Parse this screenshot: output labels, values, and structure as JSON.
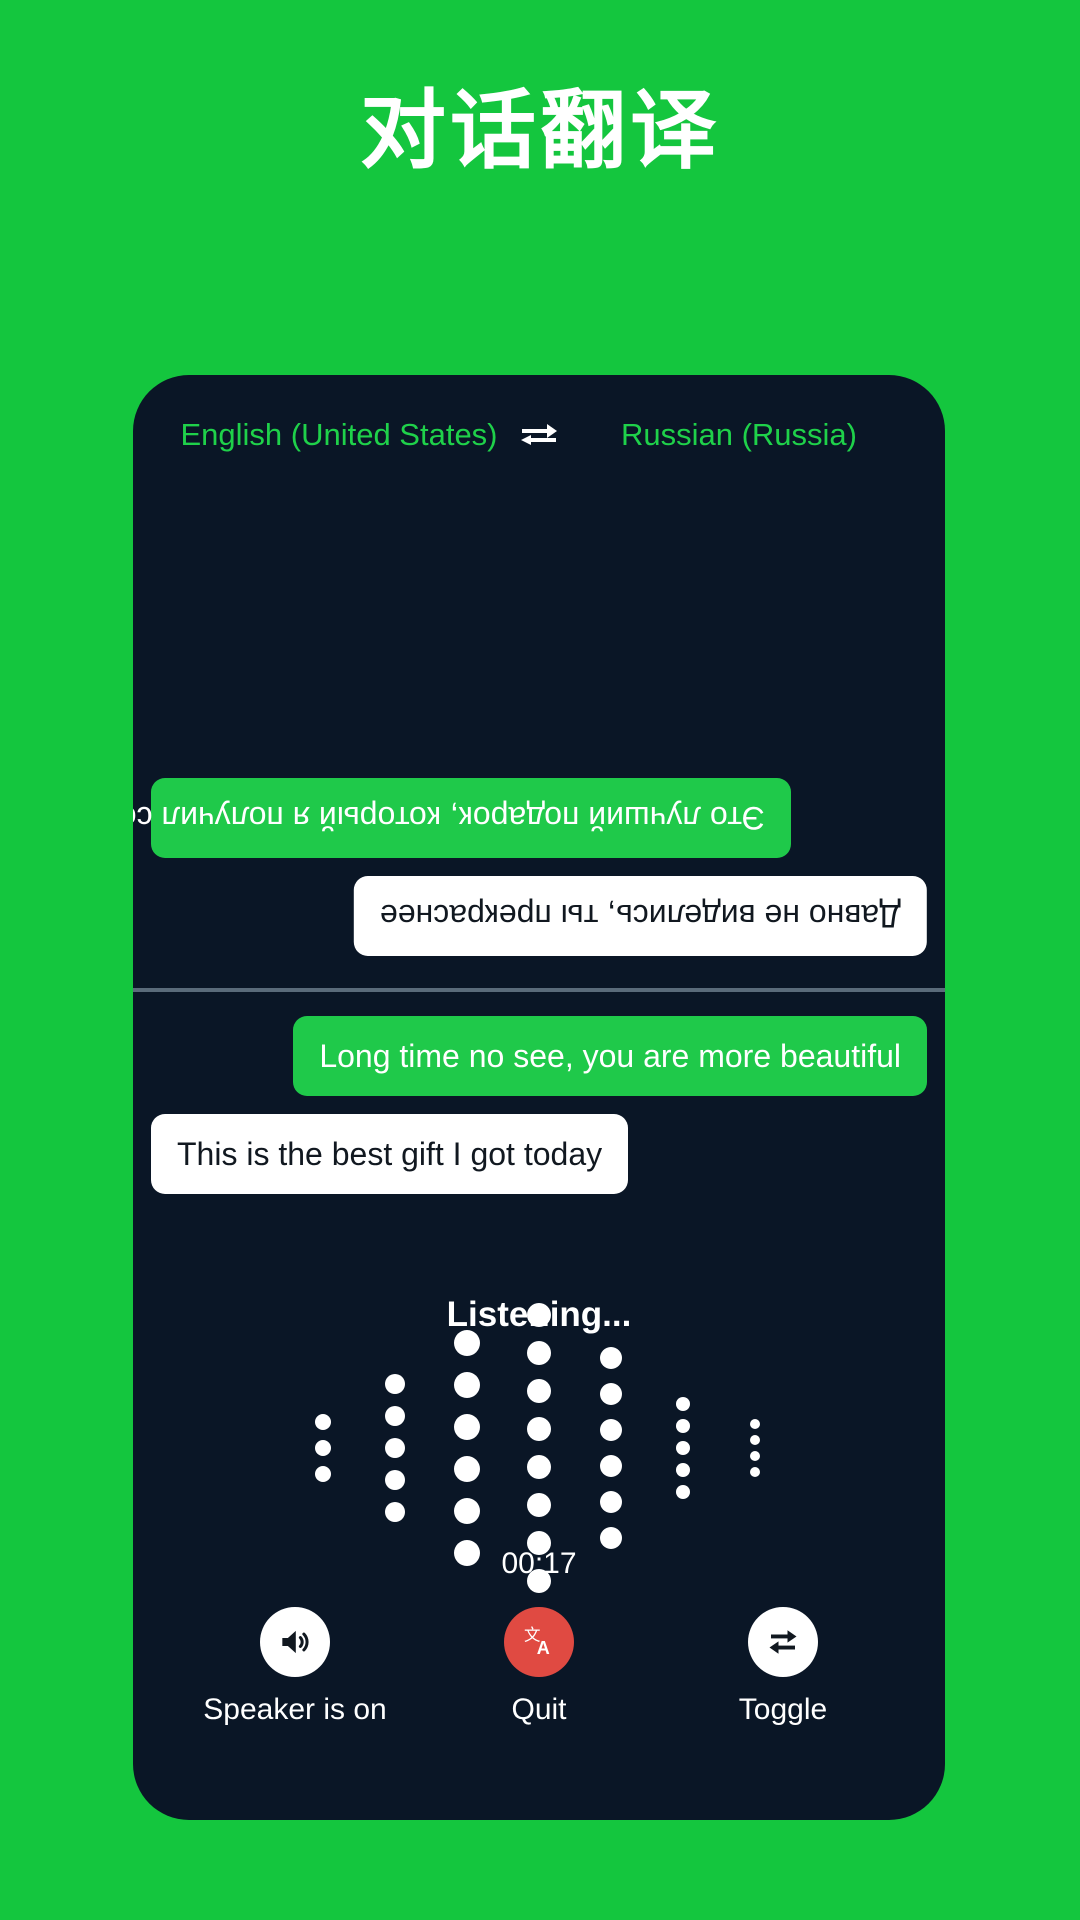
{
  "page": {
    "title": "对话翻译",
    "background_color": "#14C63E"
  },
  "phone": {
    "background_color": "#0A1626",
    "languages": {
      "source": "English (United States)",
      "target": "Russian (Russia)",
      "swap_icon": "swap-horizontal-icon",
      "text_color": "#1FD14A"
    },
    "conversation": {
      "remote_pane_rotated": true,
      "remote_messages": [
        {
          "text": "Это лучший подарок, который я получил сегодня",
          "style": "green",
          "align": "left",
          "language": "Russian"
        },
        {
          "text": "Давно не виделись, ты прекраснее",
          "style": "white",
          "align": "right",
          "language": "Russian"
        }
      ],
      "local_messages": [
        {
          "text": "Long time no see, you are more beautiful",
          "style": "green",
          "align": "right",
          "language": "English"
        },
        {
          "text": "This is the best gift I got today",
          "style": "white",
          "align": "left",
          "language": "English"
        }
      ]
    },
    "status": {
      "listening_label": "Listening...",
      "timer": "00:17"
    },
    "waveform": {
      "columns": [
        {
          "dots": 3,
          "size": 16
        },
        {
          "dots": 5,
          "size": 20
        },
        {
          "dots": 6,
          "size": 26
        },
        {
          "dots": 8,
          "size": 24
        },
        {
          "dots": 6,
          "size": 22
        },
        {
          "dots": 5,
          "size": 14
        },
        {
          "dots": 4,
          "size": 10
        }
      ],
      "dot_color": "#FFFFFF"
    },
    "controls": [
      {
        "label": "Speaker is on",
        "icon": "speaker-on-icon",
        "circle_color": "#FFFFFF",
        "icon_color": "#111820"
      },
      {
        "label": "Quit",
        "icon": "translate-icon",
        "circle_color": "#E04A42",
        "icon_color": "#FFFFFF"
      },
      {
        "label": "Toggle",
        "icon": "swap-repeat-icon",
        "circle_color": "#FFFFFF",
        "icon_color": "#111820"
      }
    ],
    "colors": {
      "bubble_green": "#1FC94A",
      "bubble_white": "#FFFFFF",
      "divider": "#5A6B7A",
      "accent_red": "#E04A42"
    }
  }
}
